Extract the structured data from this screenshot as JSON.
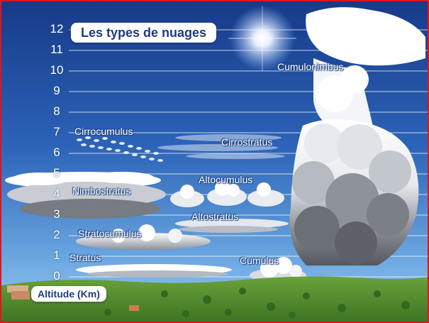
{
  "title": "Les types de nuages",
  "axis": {
    "label": "Altitude (Km)",
    "ticks": [
      "12",
      "11",
      "10",
      "9",
      "8",
      "7",
      "6",
      "5",
      "4",
      "3",
      "2",
      "1",
      "0"
    ]
  },
  "clouds": [
    {
      "name": "Cumulonimbus"
    },
    {
      "name": "Cirrocumulus"
    },
    {
      "name": "Cirrostratus"
    },
    {
      "name": "Altocumulus"
    },
    {
      "name": "Nimbostratus"
    },
    {
      "name": "Altostratus"
    },
    {
      "name": "Stratocumulus"
    },
    {
      "name": "Stratus"
    },
    {
      "name": "Cumulus"
    }
  ],
  "colors": {
    "sky_top": "#1a3f8f",
    "sky_bottom": "#8fc4ee",
    "ground": "#4f8a2e",
    "frame": "#e0141e",
    "label_box_text": "#1e3c7e"
  }
}
